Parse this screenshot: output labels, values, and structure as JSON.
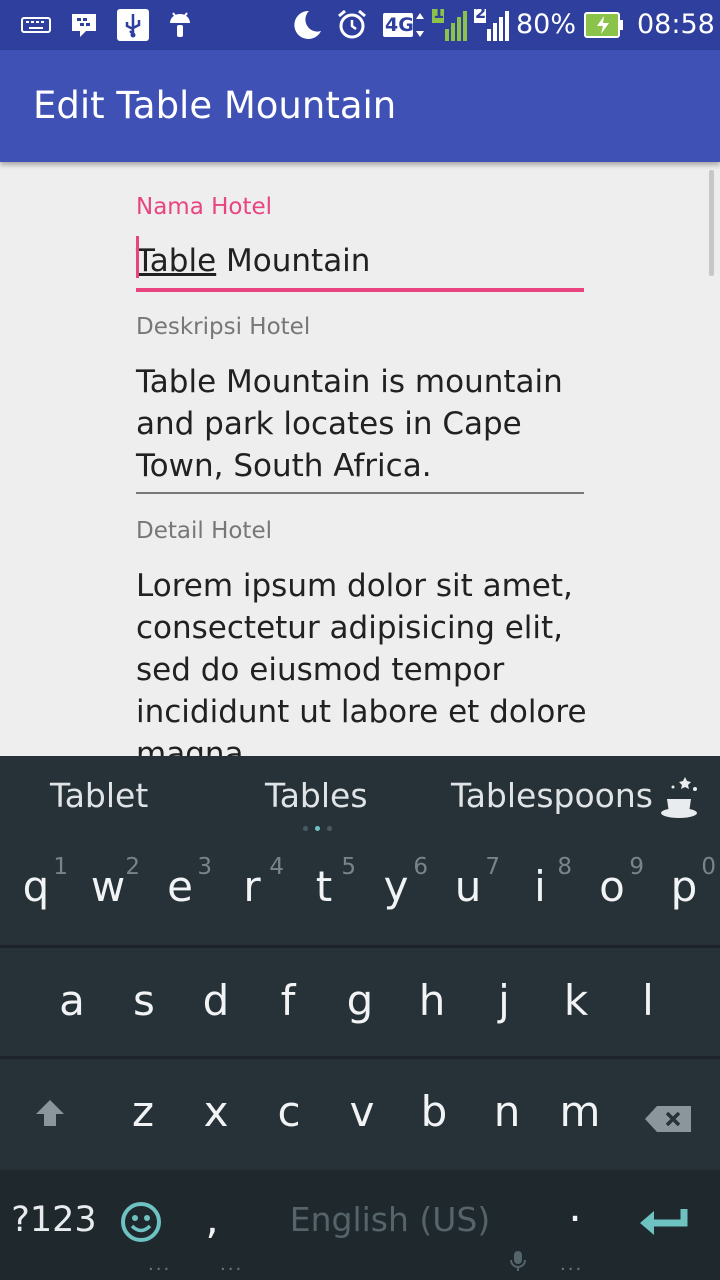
{
  "status_bar": {
    "icons": [
      "keyboard-icon",
      "bbm-icon",
      "usb-icon",
      "android-icon",
      "moon-icon",
      "alarm-icon",
      "signal-4g-icon",
      "signal-icon",
      "battery-charging-icon"
    ],
    "network_label": "4G",
    "sim1_label": "1",
    "sim2_label": "2",
    "battery": "80%",
    "time": "08:58"
  },
  "app_bar": {
    "title": "Edit Table Mountain"
  },
  "form": {
    "name_label": "Nama Hotel",
    "name_composing": "Table",
    "name_rest": " Mountain",
    "desc_label": "Deskripsi Hotel",
    "desc_value": "Table Mountain is mountain and park locates in Cape Town, South Africa.",
    "detail_label": "Detail Hotel",
    "detail_value": "Lorem ipsum dolor sit amet, consectetur adipisicing elit, sed do eiusmod tempor incididunt ut labore et dolore magna"
  },
  "keyboard": {
    "suggestions": [
      "Tablet",
      "Tables",
      "Tablespoons"
    ],
    "row1": [
      "q",
      "w",
      "e",
      "r",
      "t",
      "y",
      "u",
      "i",
      "o",
      "p"
    ],
    "row1_hints": [
      "1",
      "2",
      "3",
      "4",
      "5",
      "6",
      "7",
      "8",
      "9",
      "0"
    ],
    "row2": [
      "a",
      "s",
      "d",
      "f",
      "g",
      "h",
      "j",
      "k",
      "l"
    ],
    "row3": [
      "z",
      "x",
      "c",
      "v",
      "b",
      "n",
      "m"
    ],
    "symbols_key": "?123",
    "comma_key": ",",
    "space_label": "English (US)",
    "period_key": ".",
    "colors": {
      "accent": "#e84580",
      "primary": "#3f51b5",
      "keyboard_bg": "#263238",
      "key_accent": "#6fc2c2"
    }
  }
}
